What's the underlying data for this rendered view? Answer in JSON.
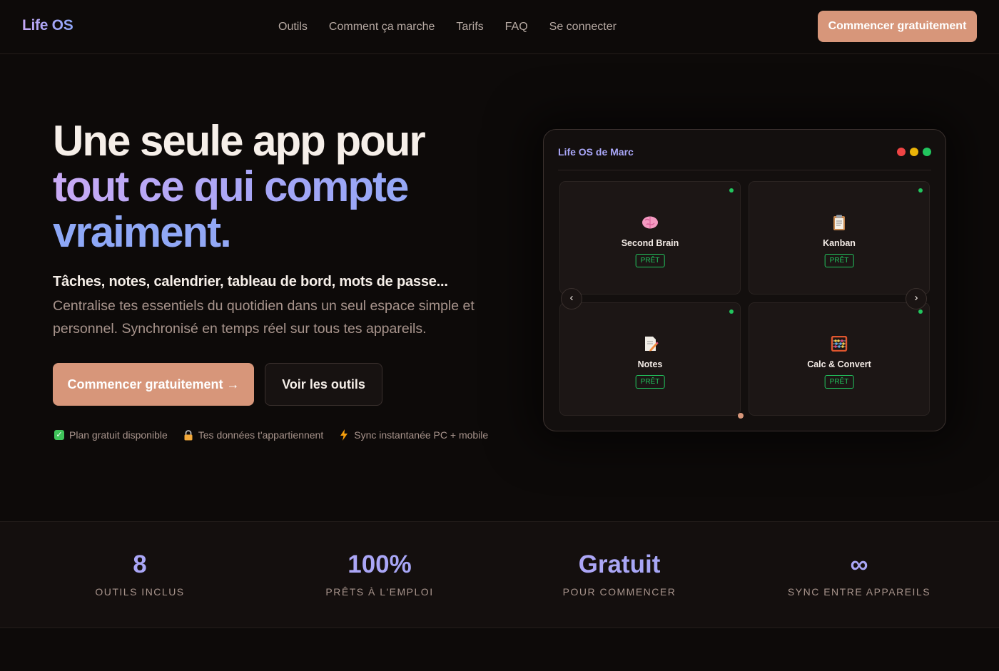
{
  "nav": {
    "logo": "Life OS",
    "links": [
      "Outils",
      "Comment ça marche",
      "Tarifs",
      "FAQ",
      "Se connecter"
    ],
    "cta": "Commencer gratuitement"
  },
  "hero": {
    "title_line1": "Une seule app pour",
    "title_line2": "tout ce qui compte",
    "title_line3": "vraiment.",
    "bold_line": "Tâches, notes, calendrier, tableau de bord, mots de passe...",
    "description": "Centralise tes essentiels du quotidien dans un seul espace simple et personnel. Synchronisé en temps réel sur tous tes appareils.",
    "primary_button": "Commencer gratuitement →",
    "secondary_button": "Voir les outils",
    "features": [
      {
        "icon": "check-icon",
        "label": "Plan gratuit disponible"
      },
      {
        "icon": "lock-icon",
        "label": "Tes données t'appartiennent"
      },
      {
        "icon": "lightning-icon",
        "label": "Sync instantanée PC + mobile"
      }
    ]
  },
  "mockup": {
    "title": "Life OS de Marc",
    "window_dots": [
      "#ef4444",
      "#eab308",
      "#22c55e"
    ],
    "tiles": [
      {
        "icon": "brain-icon",
        "name": "Second Brain",
        "badge": "PRÊT"
      },
      {
        "icon": "clipboard-icon",
        "name": "Kanban",
        "badge": "PRÊT"
      },
      {
        "icon": "memo-icon",
        "name": "Notes",
        "badge": "PRÊT"
      },
      {
        "icon": "abacus-icon",
        "name": "Calc & Convert",
        "badge": "PRÊT"
      }
    ],
    "prev_arrow": "‹",
    "next_arrow": "›"
  },
  "stats": [
    {
      "value": "8",
      "label": "OUTILS INCLUS"
    },
    {
      "value": "100%",
      "label": "PRÊTS À L'EMPLOI"
    },
    {
      "value": "Gratuit",
      "label": "POUR COMMENCER"
    },
    {
      "value": "∞",
      "label": "SYNC ENTRE APPAREILS"
    }
  ],
  "colors": {
    "accent": "#d7967a",
    "gradient_start": "#c9aaf5",
    "gradient_end": "#8da8f7",
    "status_green": "#22c55e",
    "background": "#0d0a09"
  }
}
